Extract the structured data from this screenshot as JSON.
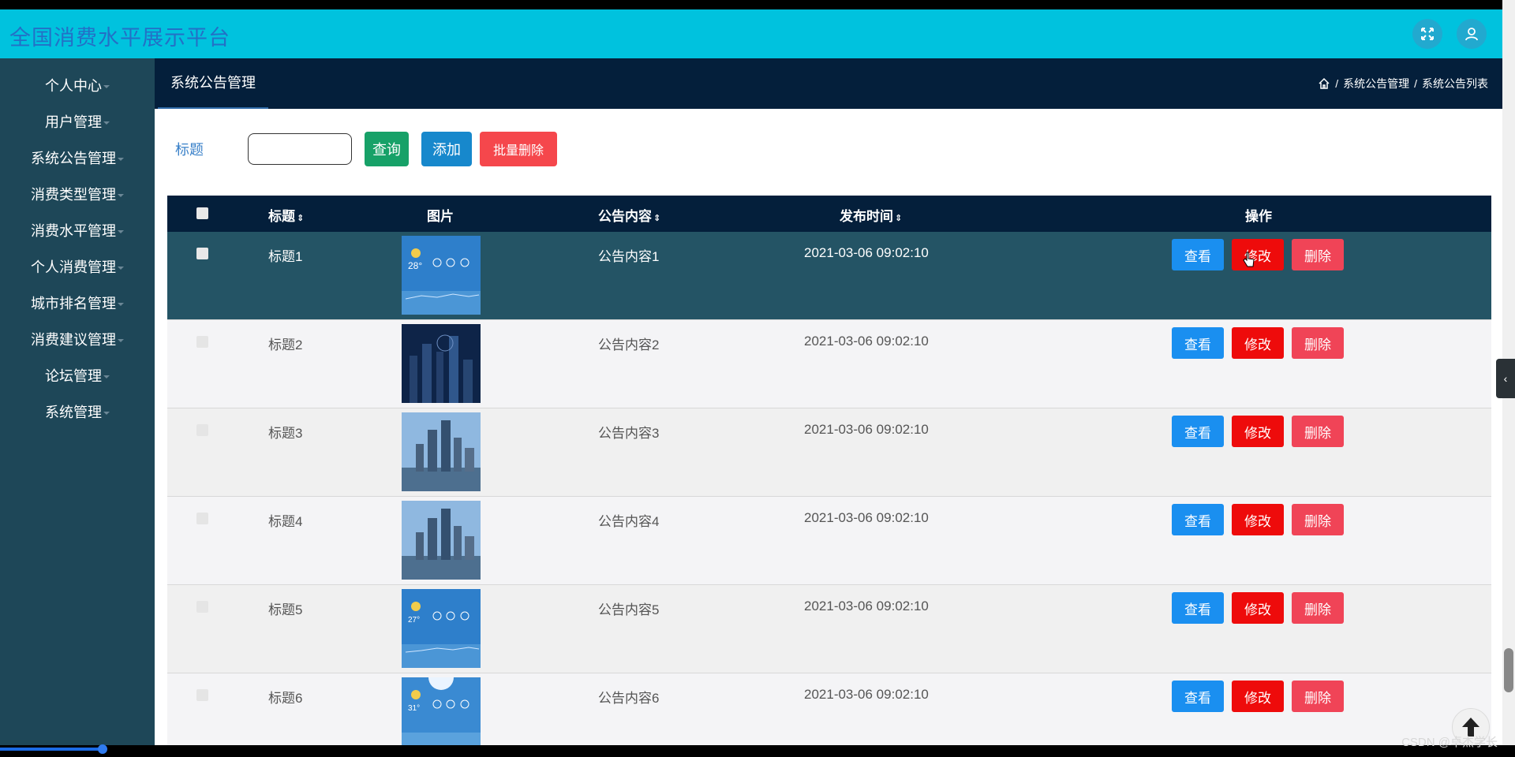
{
  "app": {
    "title": "全国消费水平展示平台"
  },
  "topbar": {
    "fullscreen_icon": "expand-icon",
    "user_icon": "user-icon"
  },
  "sidebar": {
    "items": [
      {
        "label": "个人中心"
      },
      {
        "label": "用户管理"
      },
      {
        "label": "系统公告管理"
      },
      {
        "label": "消费类型管理"
      },
      {
        "label": "消费水平管理"
      },
      {
        "label": "个人消费管理"
      },
      {
        "label": "城市排名管理"
      },
      {
        "label": "消费建议管理"
      },
      {
        "label": "论坛管理"
      },
      {
        "label": "系统管理"
      }
    ]
  },
  "header": {
    "tab": "系统公告管理",
    "breadcrumb": {
      "sep": "/",
      "level1": "系统公告管理",
      "level2": "系统公告列表"
    }
  },
  "search": {
    "label": "标题",
    "value": "",
    "placeholder": "",
    "query_label": "查询",
    "add_label": "添加",
    "bulk_delete_label": "批量删除"
  },
  "table": {
    "columns": {
      "title": "标题",
      "image": "图片",
      "content": "公告内容",
      "time": "发布时间",
      "actions": "操作"
    },
    "actions": {
      "view": "查看",
      "edit": "修改",
      "delete": "删除"
    },
    "rows": [
      {
        "title": "标题1",
        "content": "公告内容1",
        "time": "2021-03-06 09:02:10",
        "image": "weather"
      },
      {
        "title": "标题2",
        "content": "公告内容2",
        "time": "2021-03-06 09:02:10",
        "image": "city-night"
      },
      {
        "title": "标题3",
        "content": "公告内容3",
        "time": "2021-03-06 09:02:10",
        "image": "skyline"
      },
      {
        "title": "标题4",
        "content": "公告内容4",
        "time": "2021-03-06 09:02:10",
        "image": "skyline"
      },
      {
        "title": "标题5",
        "content": "公告内容5",
        "time": "2021-03-06 09:02:10",
        "image": "weather"
      },
      {
        "title": "标题6",
        "content": "公告内容6",
        "time": "2021-03-06 09:02:10",
        "image": "weather"
      }
    ]
  },
  "watermark": "CSDN @卓杰学长",
  "colors": {
    "topbar": "#00c2de",
    "sidebar": "#1e4758",
    "subheader": "#041f3b",
    "view": "#1a8ff0",
    "edit": "#ee0b0b",
    "delete": "#f04457",
    "query": "#17a168",
    "add": "#1788cc",
    "bulk_delete": "#f5474c"
  }
}
